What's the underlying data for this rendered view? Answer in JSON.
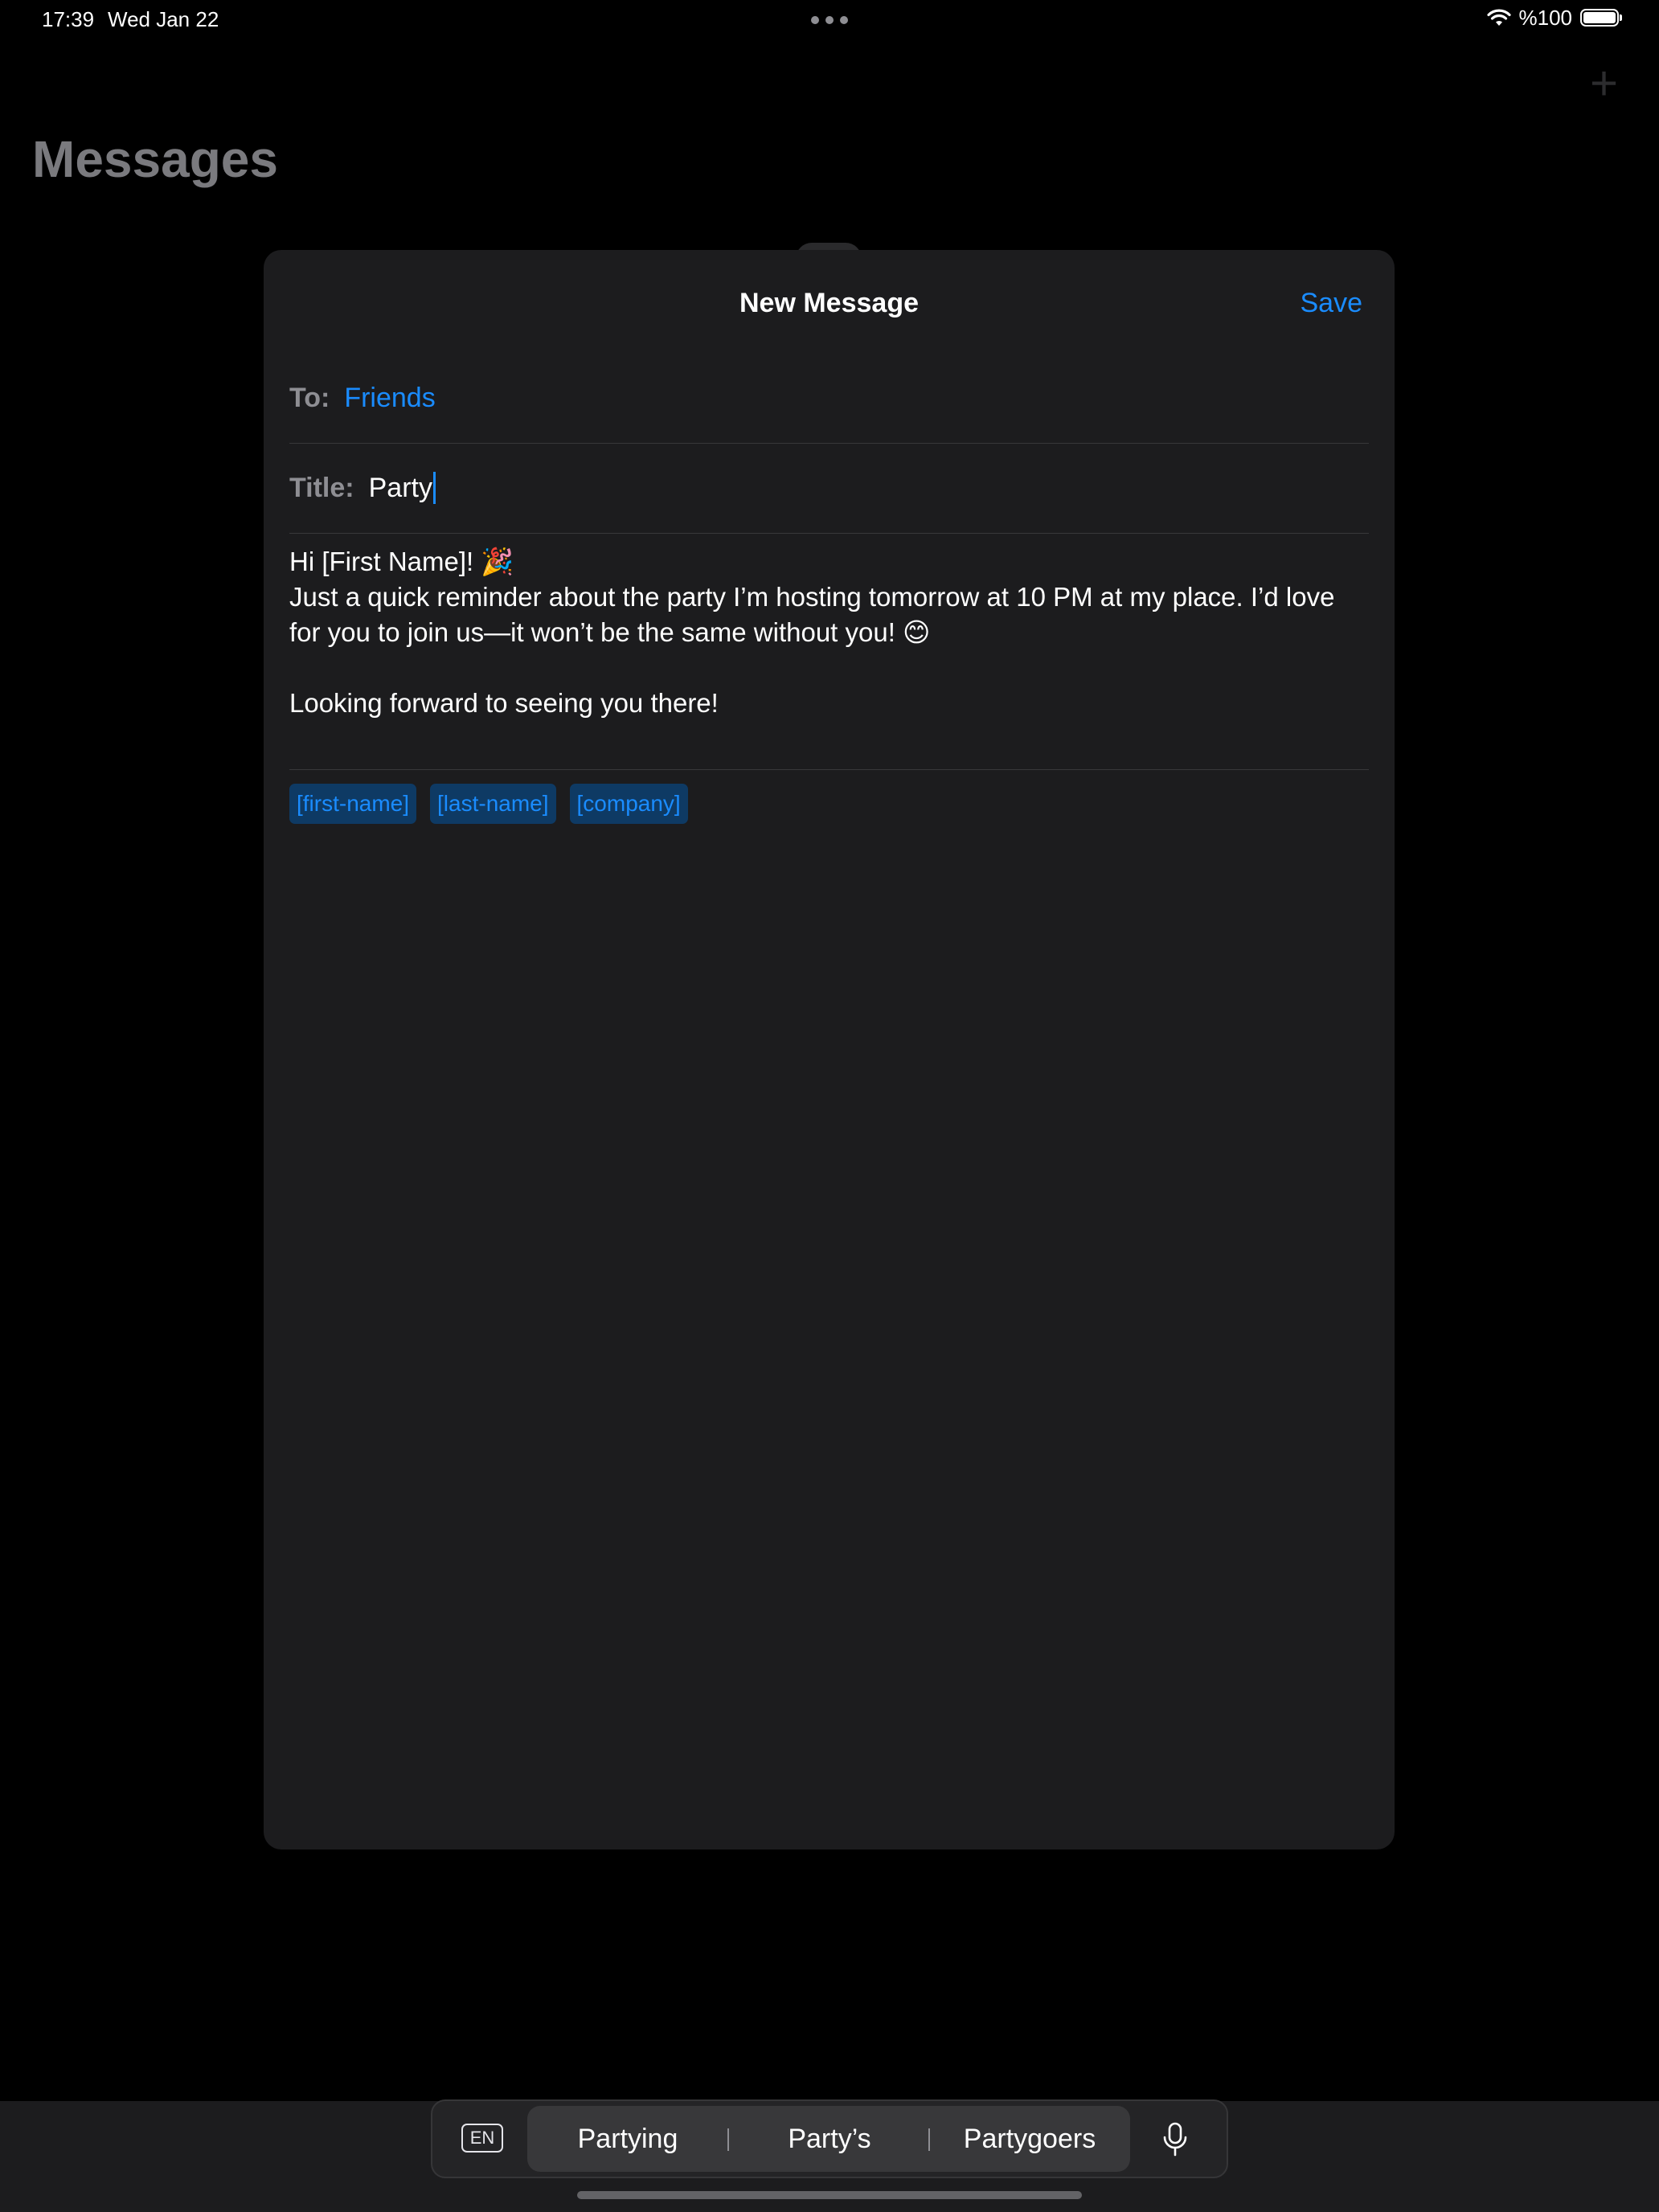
{
  "status_bar": {
    "time": "17:39",
    "date": "Wed Jan 22",
    "battery": "%100"
  },
  "background_app": {
    "title": "Messages",
    "add_icon": "plus-icon"
  },
  "sheet": {
    "title": "New Message",
    "save_label": "Save",
    "to_label": "To:",
    "to_value": "Friends",
    "title_label": "Title:",
    "title_value": "Party",
    "body": "Hi [First Name]! 🎉\nJust a quick reminder about the party I’m hosting tomorrow at 10 PM at my place. I’d love for you to join us—it won’t be the same without you! 😊\n\nLooking forward to seeing you there!",
    "tags": [
      "[first-name]",
      "[last-name]",
      "[company]"
    ]
  },
  "keyboard": {
    "language": "EN",
    "suggestions": [
      "Partying",
      "Party’s",
      "Partygoers"
    ],
    "mic_icon": "microphone-icon"
  },
  "colors": {
    "accent": "#1a8cff",
    "sheet_background": "#1c1c1e",
    "tag_background": "#0e3a64"
  }
}
